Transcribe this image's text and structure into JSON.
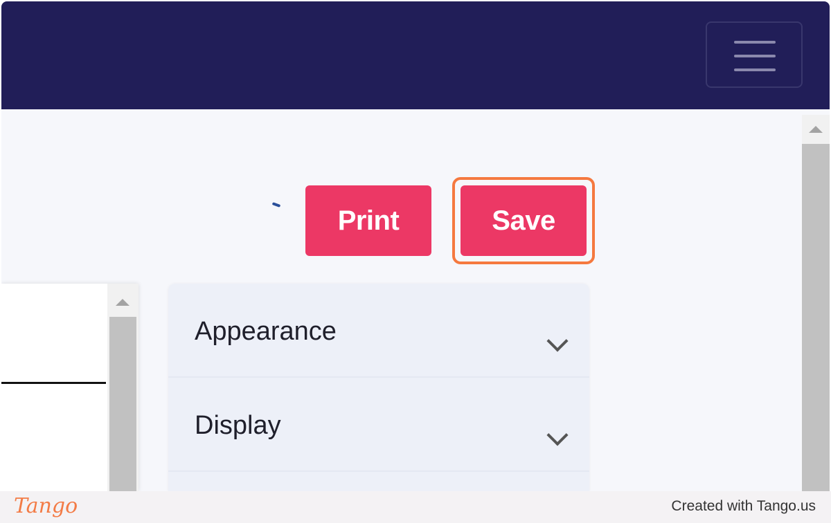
{
  "header": {
    "menu_icon": "hamburger-menu-icon"
  },
  "toolbar": {
    "print_label": "Print",
    "save_label": "Save"
  },
  "settings": {
    "sections": [
      {
        "label": "Appearance",
        "icon": "chevron-down-icon"
      },
      {
        "label": "Display",
        "icon": "chevron-down-icon"
      }
    ]
  },
  "footer": {
    "logo": "Tango",
    "credit": "Created with Tango.us"
  },
  "colors": {
    "header_bg": "#211e58",
    "button_bg": "#ec3865",
    "highlight": "#f5793f",
    "accordion_bg": "#edf0f8"
  }
}
